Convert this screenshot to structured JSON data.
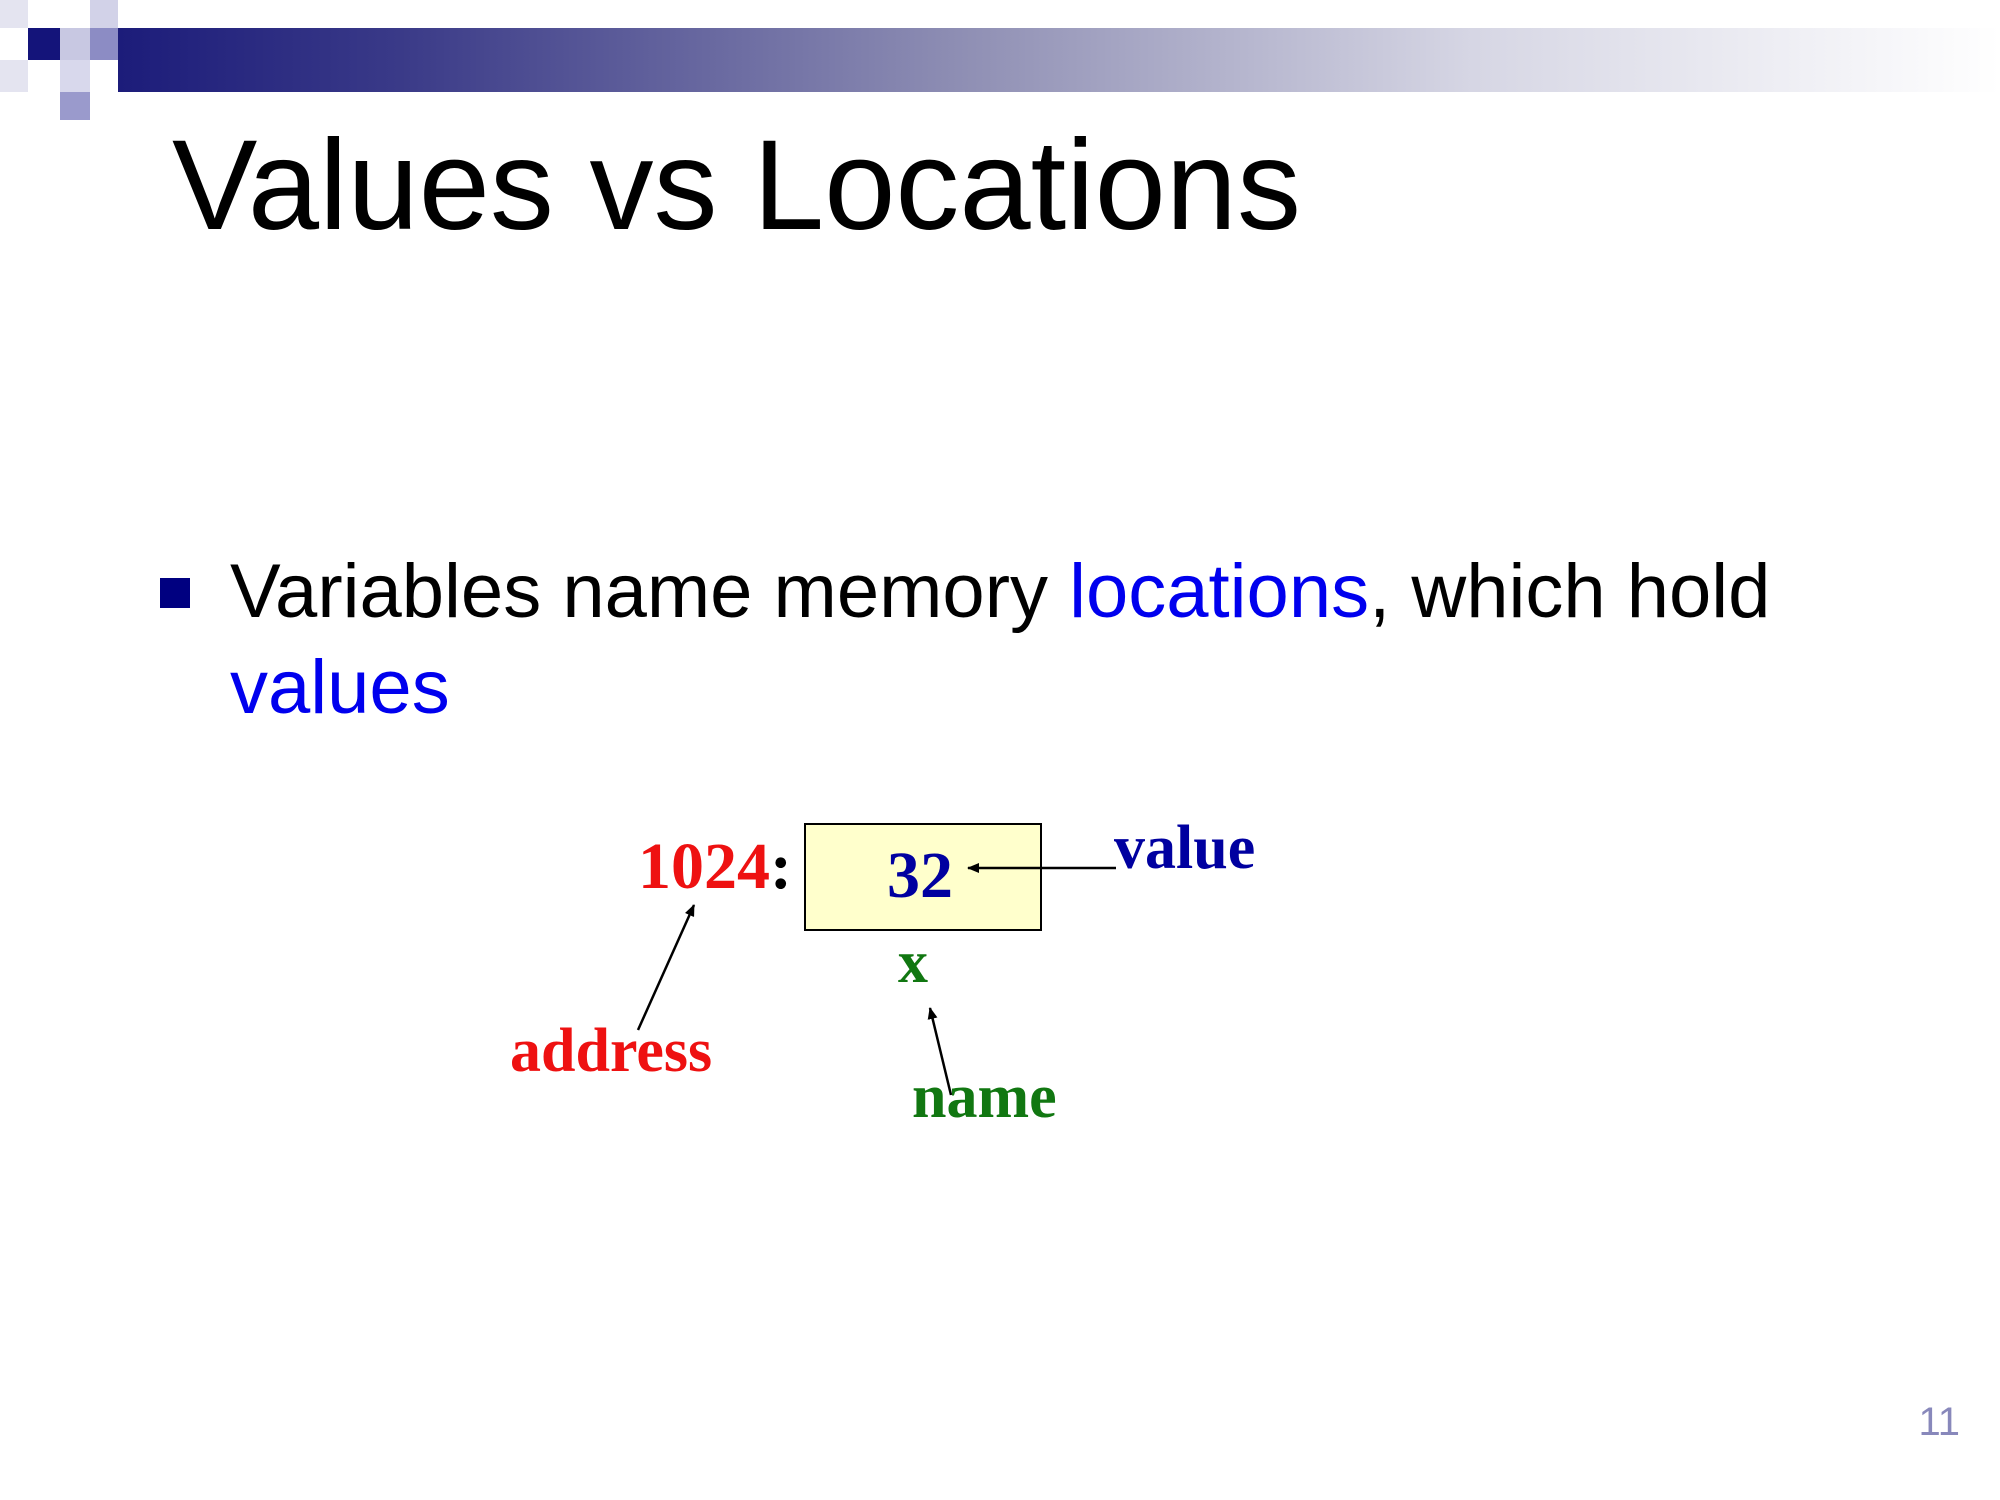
{
  "slide": {
    "title": "Values vs Locations",
    "bullet": {
      "text_before": "Variables name memory ",
      "highlight_1": "locations",
      "text_middle": ", which hold ",
      "highlight_2": "values"
    },
    "diagram": {
      "address_number": "1024",
      "address_colon": ":",
      "cell_value": "32",
      "variable_name": "x",
      "label_value": "value",
      "label_address": "address",
      "label_name": "name"
    },
    "page_number": "11"
  },
  "colors": {
    "title_text": "#000000",
    "bullet_marker": "#000080",
    "highlight_blue": "#0000ee",
    "value_blue": "#0000a0",
    "address_red": "#ee1111",
    "name_green": "#117711",
    "cell_fill": "#ffffcc",
    "page_number": "#8888bb",
    "header_gradient_start": "#1c1c7a"
  }
}
